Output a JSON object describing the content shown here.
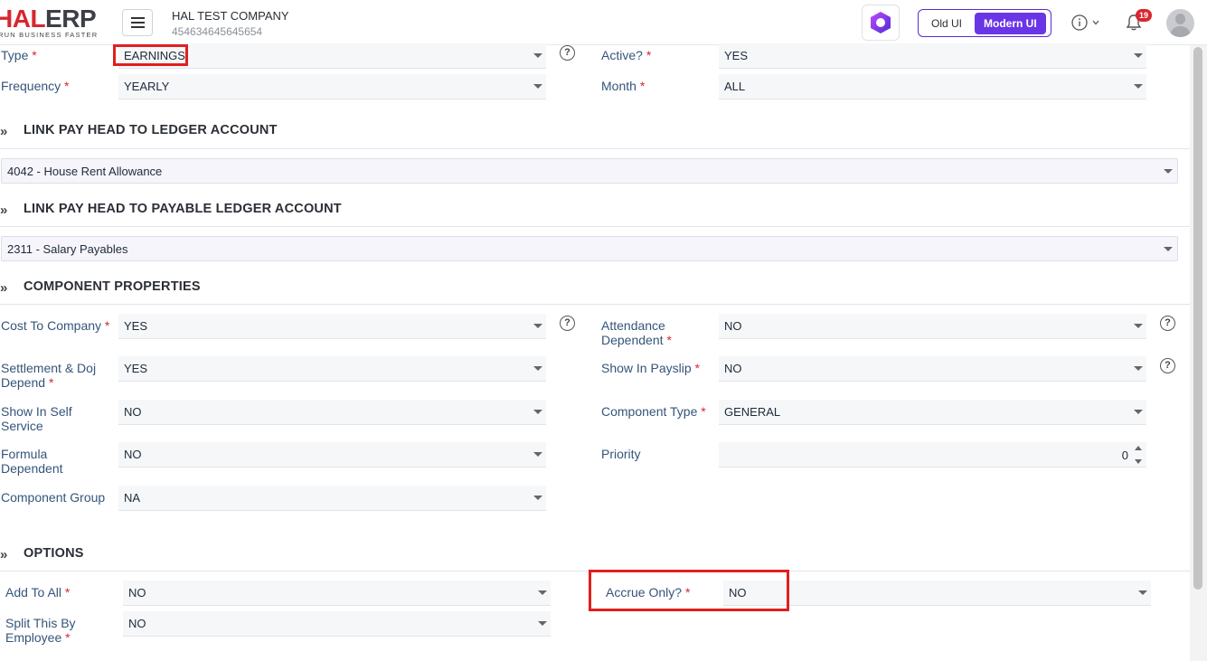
{
  "header": {
    "logo_main": "HAL",
    "logo_erp": "ERP",
    "logo_tagline": "RUN BUSINESS FASTER",
    "company_name": "HAL TEST COMPANY",
    "company_id": "454634645645654",
    "toggle_old": "Old UI",
    "toggle_modern": "Modern UI",
    "notification_count": "19"
  },
  "form": {
    "type": {
      "label": "Type",
      "value": "EARNINGS"
    },
    "active": {
      "label": "Active?",
      "value": "YES"
    },
    "frequency": {
      "label": "Frequency",
      "value": "YEARLY"
    },
    "month": {
      "label": "Month",
      "value": "ALL"
    }
  },
  "sections": {
    "ledger": {
      "title": "LINK PAY HEAD TO LEDGER ACCOUNT",
      "value": "4042 - House Rent Allowance"
    },
    "payable": {
      "title": "LINK PAY HEAD TO PAYABLE LEDGER ACCOUNT",
      "value": "2311 - Salary Payables"
    },
    "component": {
      "title": "COMPONENT PROPERTIES",
      "cost_to_company": {
        "label": "Cost To Company",
        "value": "YES"
      },
      "attendance_dependent_l1": "Attendance",
      "attendance_dependent_l2": "Dependent",
      "attendance_dependent_value": "NO",
      "settlement_l1": "Settlement & Doj",
      "settlement_l2": "Depend",
      "settlement_value": "YES",
      "show_in_payslip": {
        "label": "Show In Payslip",
        "value": "NO"
      },
      "self_service_l1": "Show In Self",
      "self_service_l2": "Service",
      "self_service_value": "NO",
      "component_type": {
        "label": "Component Type",
        "value": "GENERAL"
      },
      "formula_l1": "Formula",
      "formula_l2": "Dependent",
      "formula_value": "NO",
      "priority": {
        "label": "Priority",
        "value": "0"
      },
      "component_group": {
        "label": "Component Group",
        "value": "NA"
      }
    },
    "options": {
      "title": "OPTIONS",
      "add_to_all": {
        "label": "Add To All",
        "value": "NO"
      },
      "accrue_only": {
        "label": "Accrue Only?",
        "value": "NO"
      },
      "split_l1": "Split This By",
      "split_l2": "Employee",
      "split_value": "NO"
    }
  },
  "required_mark": "*",
  "help_glyph": "?",
  "section_glyph": "»"
}
